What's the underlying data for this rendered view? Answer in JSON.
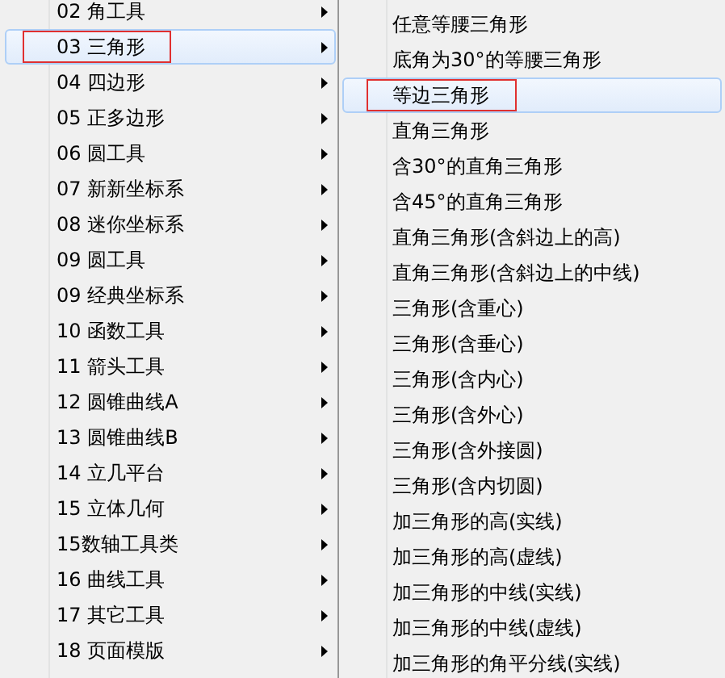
{
  "main_menu": {
    "items": [
      {
        "label": "02 角工具",
        "selected": false,
        "has_submenu": true
      },
      {
        "label": "03 三角形",
        "selected": true,
        "has_submenu": true
      },
      {
        "label": "04 四边形",
        "selected": false,
        "has_submenu": true
      },
      {
        "label": "05 正多边形",
        "selected": false,
        "has_submenu": true
      },
      {
        "label": "06 圆工具",
        "selected": false,
        "has_submenu": true
      },
      {
        "label": "07 新新坐标系",
        "selected": false,
        "has_submenu": true
      },
      {
        "label": "08 迷你坐标系",
        "selected": false,
        "has_submenu": true
      },
      {
        "label": "09 圆工具",
        "selected": false,
        "has_submenu": true
      },
      {
        "label": "09 经典坐标系",
        "selected": false,
        "has_submenu": true
      },
      {
        "label": "10 函数工具",
        "selected": false,
        "has_submenu": true
      },
      {
        "label": "11 箭头工具",
        "selected": false,
        "has_submenu": true
      },
      {
        "label": "12 圆锥曲线A",
        "selected": false,
        "has_submenu": true
      },
      {
        "label": "13 圆锥曲线B",
        "selected": false,
        "has_submenu": true
      },
      {
        "label": "14 立几平台",
        "selected": false,
        "has_submenu": true
      },
      {
        "label": "15 立体几何",
        "selected": false,
        "has_submenu": true
      },
      {
        "label": "15数轴工具类",
        "selected": false,
        "has_submenu": true
      },
      {
        "label": "16 曲线工具",
        "selected": false,
        "has_submenu": true
      },
      {
        "label": "17 其它工具",
        "selected": false,
        "has_submenu": true
      },
      {
        "label": "18 页面模版",
        "selected": false,
        "has_submenu": true
      }
    ]
  },
  "submenu": {
    "items": [
      {
        "label": "任意等腰三角形",
        "selected": false
      },
      {
        "label": "底角为30°的等腰三角形",
        "selected": false
      },
      {
        "label": "等边三角形",
        "selected": true
      },
      {
        "label": "直角三角形",
        "selected": false
      },
      {
        "label": "含30°的直角三角形",
        "selected": false
      },
      {
        "label": "含45°的直角三角形",
        "selected": false
      },
      {
        "label": "直角三角形(含斜边上的高)",
        "selected": false
      },
      {
        "label": "直角三角形(含斜边上的中线)",
        "selected": false
      },
      {
        "label": "三角形(含重心)",
        "selected": false
      },
      {
        "label": "三角形(含垂心)",
        "selected": false
      },
      {
        "label": "三角形(含内心)",
        "selected": false
      },
      {
        "label": "三角形(含外心)",
        "selected": false
      },
      {
        "label": "三角形(含外接圆)",
        "selected": false
      },
      {
        "label": "三角形(含内切圆)",
        "selected": false
      },
      {
        "label": "加三角形的高(实线)",
        "selected": false
      },
      {
        "label": "加三角形的高(虚线)",
        "selected": false
      },
      {
        "label": "加三角形的中线(实线)",
        "selected": false
      },
      {
        "label": "加三角形的中线(虚线)",
        "selected": false
      },
      {
        "label": "加三角形的角平分线(实线)",
        "selected": false
      }
    ]
  }
}
